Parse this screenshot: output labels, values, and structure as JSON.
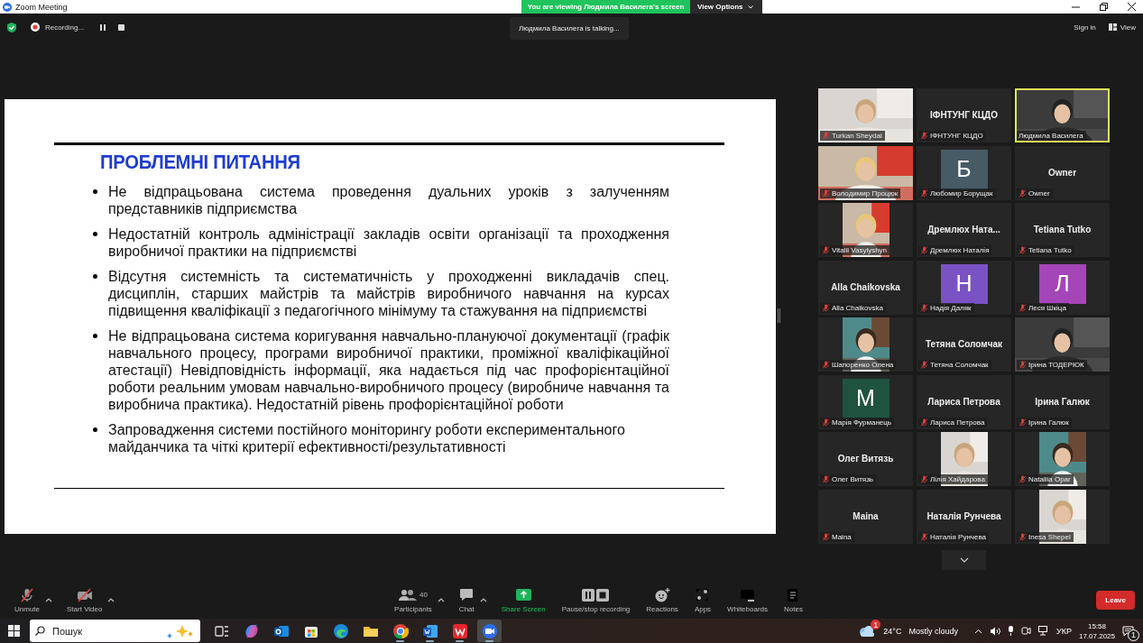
{
  "window": {
    "title": "Zoom Meeting"
  },
  "banner": {
    "text": "You are viewing Людмила Василега's screen",
    "button": "View Options"
  },
  "top_bar": {
    "recording": "Recording...",
    "talking": "Людмила Василега is talking...",
    "sign_in": "Sign in",
    "view": "View"
  },
  "slide": {
    "title": "ПРОБЛЕМНІ ПИТАННЯ",
    "bullets": [
      {
        "text": "Не відпрацьована система проведення дуальних уроків з залученням представників підприємства",
        "justified": true
      },
      {
        "text": "Недостатній контроль адміністрації закладів освіти організації та проходження виробничої практики на підприємстві",
        "justified": true
      },
      {
        "text": "Відсутня системність та систематичність у проходженні викладачів спец. дисциплін, старших майстрів та майстрів виробничого навчання на курсах підвищення кваліфікації з педагогічного мінімуму та стажування на підприємстві",
        "justified": true
      },
      {
        "text": "Не відпрацьована система коригування навчально-плануючої документації (графік навчального процесу, програми виробничої практики, проміжної кваліфікаційної атестації) Невідповідність інформації, яка надається під час профорієнтаційної роботи реальним умовам навчально-виробничого процесу (виробниче навчання та виробнича практика). Недостатній рівень профорієнтаційної роботи",
        "justified": true
      },
      {
        "text": "Запровадження системи постійного моніторингу роботи експериментального майданчика та чіткі критерії ефективності/результативності",
        "justified": false
      }
    ]
  },
  "gallery": {
    "tiles": [
      {
        "name": "Turkan Sheydai",
        "kind": "video",
        "muted": true,
        "active_speaker": false
      },
      {
        "name": "ІФНТУНГ КЦДО",
        "kind": "name",
        "display": "ІФНТУНГ КЦДО",
        "muted": true,
        "active_speaker": false
      },
      {
        "name": "Людмила Василега",
        "kind": "video",
        "muted": false,
        "active_speaker": true
      },
      {
        "name": "Володимир Процюк",
        "kind": "video",
        "muted": true,
        "active_speaker": false
      },
      {
        "name": "Любомир Борущак",
        "kind": "avatar",
        "initial": "Б",
        "color": "#465b66",
        "muted": true,
        "active_speaker": false
      },
      {
        "name": "Owner",
        "kind": "name",
        "display": "Owner",
        "muted": true,
        "active_speaker": false
      },
      {
        "name": "Vitalii Vasylyshyn",
        "muted": true,
        "active_speaker": false
      },
      {
        "name": "Дремлюх Наталія",
        "kind": "name",
        "display": "Дремлюх  Ната...",
        "muted": true,
        "active_speaker": false
      },
      {
        "name": "Tetiana Tutko",
        "kind": "name",
        "display": "Tetiana Tutko",
        "muted": true,
        "active_speaker": false
      },
      {
        "name": "Alla Chaikovska",
        "kind": "name",
        "display": "Alla Chaikovska",
        "muted": true,
        "active_speaker": false
      },
      {
        "name": "Надія Даляк",
        "kind": "avatar",
        "initial": "Н",
        "color": "#7b52c4",
        "muted": true,
        "active_speaker": false
      },
      {
        "name": "Леся Шкіца",
        "kind": "avatar",
        "initial": "Л",
        "color": "#a445b8",
        "muted": true,
        "active_speaker": false
      },
      {
        "name": "Шапоренко Олена",
        "muted": true,
        "active_speaker": false
      },
      {
        "name": "Тетяна Соломчак",
        "kind": "name",
        "display": "Тетяна Соломчак",
        "muted": true,
        "active_speaker": false
      },
      {
        "name": "Ірина ТОДЕРЮК",
        "kind": "video",
        "muted": true,
        "active_speaker": false
      },
      {
        "name": "Марія Фурманець",
        "kind": "avatar",
        "initial": "M",
        "color": "#1f5340",
        "muted": true,
        "active_speaker": false
      },
      {
        "name": "Лариса Петрова",
        "kind": "name",
        "display": "Лариса Петрова",
        "muted": true,
        "active_speaker": false
      },
      {
        "name": "Ірина Галюк",
        "kind": "name",
        "display": "Ірина Галюк",
        "muted": true,
        "active_speaker": false
      },
      {
        "name": "Олег Витязь",
        "kind": "name",
        "display": "Олег Витязь",
        "muted": true,
        "active_speaker": false
      },
      {
        "name": "Лілія Хайдарова",
        "muted": true,
        "active_speaker": false
      },
      {
        "name": "Nataliia Opar",
        "muted": true,
        "active_speaker": false
      },
      {
        "name": "Maina",
        "kind": "name",
        "display": "Maina",
        "muted": true,
        "active_speaker": false
      },
      {
        "name": "Наталія Рунчева",
        "kind": "name",
        "display": "Наталія Рунчева",
        "muted": true,
        "active_speaker": false
      },
      {
        "name": "Inesa Shepel",
        "muted": true,
        "active_speaker": false
      }
    ]
  },
  "toolbar": {
    "left": [
      {
        "label": "Unmute",
        "kind": "mic",
        "has_menu": true
      },
      {
        "label": "Start Video",
        "kind": "video",
        "has_menu": true
      }
    ],
    "center": [
      {
        "label": "Participants",
        "kind": "participants",
        "count": "40",
        "has_menu": true
      },
      {
        "label": "Chat",
        "kind": "chat",
        "has_menu": true
      },
      {
        "label": "Share Screen",
        "kind": "share",
        "has_menu": false
      },
      {
        "label": "Pause/stop recording",
        "kind": "recording",
        "has_menu": false
      },
      {
        "label": "Reactions",
        "kind": "reactions",
        "has_menu": false
      },
      {
        "label": "Apps",
        "kind": "apps",
        "has_menu": false
      },
      {
        "label": "Whiteboards",
        "kind": "whiteboards",
        "has_menu": false
      },
      {
        "label": "Notes",
        "kind": "notes",
        "has_menu": false
      }
    ],
    "leave": "Leave"
  },
  "taskbar": {
    "search": {
      "placeholder": "Пошук"
    },
    "apps": [
      {
        "kind": "taskview",
        "running": false,
        "selected": false
      },
      {
        "kind": "copilot",
        "running": false,
        "selected": false
      },
      {
        "kind": "mail",
        "running": false,
        "selected": false
      },
      {
        "kind": "store",
        "running": false,
        "selected": false
      },
      {
        "kind": "edge",
        "running": false,
        "selected": false
      },
      {
        "kind": "folder",
        "running": false,
        "selected": false
      },
      {
        "kind": "chrome",
        "running": true,
        "selected": false
      },
      {
        "kind": "word",
        "running": true,
        "selected": false
      },
      {
        "kind": "wps",
        "running": true,
        "selected": false
      },
      {
        "kind": "zoom",
        "running": true,
        "selected": true
      }
    ],
    "weather": {
      "badge": "1",
      "temperature": "24°C",
      "condition": "Mostly cloudy"
    },
    "language": "УКР",
    "time": "15:58",
    "date": "17.07.2025",
    "notifications": "1"
  }
}
